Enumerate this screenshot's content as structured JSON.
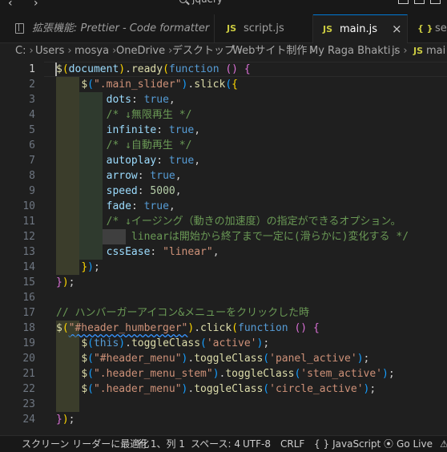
{
  "titlebar": {
    "back": "‹",
    "forward": "›",
    "search_text": "jquery"
  },
  "tabs": [
    {
      "icon": "",
      "label": "拡張機能: Prettier - Code formatter",
      "active": false,
      "italic": true
    },
    {
      "icon": "JS",
      "label": "script.js",
      "active": false
    },
    {
      "icon": "JS",
      "label": "main.js",
      "active": true,
      "close": "×"
    },
    {
      "icon": "{ }",
      "label": "set",
      "active": false
    }
  ],
  "breadcrumbs": [
    "C:",
    "Users",
    "mosya",
    "OneDrive",
    "デスクトップ",
    "Webサイト制作",
    "My Raga Bhakti",
    "js",
    "mai"
  ],
  "breadcrumb_last_icon": "JS",
  "editor": {
    "lines": [
      {
        "n": "1",
        "tokens": [
          [
            "t-fn",
            "$"
          ],
          [
            "t-b1",
            "("
          ],
          [
            "t-prop",
            "document"
          ],
          [
            "t-b1",
            ")"
          ],
          [
            "t-punc",
            "."
          ],
          [
            "t-fn",
            "ready"
          ],
          [
            "t-b1",
            "("
          ],
          [
            "t-kw",
            "function"
          ],
          [
            "t-punc",
            " "
          ],
          [
            "t-b2",
            "()"
          ],
          [
            "t-punc",
            " "
          ],
          [
            "t-b2",
            "{"
          ]
        ]
      },
      {
        "n": "2",
        "tokens": [
          [
            "t-punc",
            "    "
          ],
          [
            "t-fn",
            "$"
          ],
          [
            "t-b3",
            "("
          ],
          [
            "t-str",
            "\".main_slider\""
          ],
          [
            "t-b3",
            ")"
          ],
          [
            "t-punc",
            "."
          ],
          [
            "t-fn",
            "slick"
          ],
          [
            "t-b3",
            "("
          ],
          [
            "t-b1",
            "{"
          ]
        ]
      },
      {
        "n": "3",
        "tokens": [
          [
            "t-punc",
            "        "
          ],
          [
            "t-prop",
            "dots"
          ],
          [
            "t-punc",
            ": "
          ],
          [
            "t-kw",
            "true"
          ],
          [
            "t-punc",
            ","
          ]
        ]
      },
      {
        "n": "4",
        "tokens": [
          [
            "t-punc",
            "        "
          ],
          [
            "t-com",
            "/* ↓無限再生 */"
          ]
        ]
      },
      {
        "n": "5",
        "tokens": [
          [
            "t-punc",
            "        "
          ],
          [
            "t-prop",
            "infinite"
          ],
          [
            "t-punc",
            ": "
          ],
          [
            "t-kw",
            "true"
          ],
          [
            "t-punc",
            ","
          ]
        ]
      },
      {
        "n": "6",
        "tokens": [
          [
            "t-punc",
            "        "
          ],
          [
            "t-com",
            "/* ↓自動再生 */"
          ]
        ]
      },
      {
        "n": "7",
        "tokens": [
          [
            "t-punc",
            "        "
          ],
          [
            "t-prop",
            "autoplay"
          ],
          [
            "t-punc",
            ": "
          ],
          [
            "t-kw",
            "true"
          ],
          [
            "t-punc",
            ","
          ]
        ]
      },
      {
        "n": "8",
        "tokens": [
          [
            "t-punc",
            "        "
          ],
          [
            "t-prop",
            "arrow"
          ],
          [
            "t-punc",
            ": "
          ],
          [
            "t-kw",
            "true"
          ],
          [
            "t-punc",
            ","
          ]
        ]
      },
      {
        "n": "9",
        "tokens": [
          [
            "t-punc",
            "        "
          ],
          [
            "t-prop",
            "speed"
          ],
          [
            "t-punc",
            ": "
          ],
          [
            "t-num",
            "5000"
          ],
          [
            "t-punc",
            ","
          ]
        ]
      },
      {
        "n": "10",
        "tokens": [
          [
            "t-punc",
            "        "
          ],
          [
            "t-prop",
            "fade"
          ],
          [
            "t-punc",
            ": "
          ],
          [
            "t-kw",
            "true"
          ],
          [
            "t-punc",
            ","
          ]
        ]
      },
      {
        "n": "11",
        "tokens": [
          [
            "t-punc",
            "        "
          ],
          [
            "t-com",
            "/* ↓イージング（動きの加速度）の指定ができるオプション。"
          ]
        ]
      },
      {
        "n": "12",
        "tokens": [
          [
            "t-punc",
            "            "
          ],
          [
            "t-com",
            "linearは開始から終了まで一定に(滑らかに)変化する */"
          ]
        ]
      },
      {
        "n": "13",
        "tokens": [
          [
            "t-punc",
            "        "
          ],
          [
            "t-prop",
            "cssEase"
          ],
          [
            "t-punc",
            ": "
          ],
          [
            "t-str",
            "\"linear\""
          ],
          [
            "t-punc",
            ","
          ]
        ]
      },
      {
        "n": "14",
        "tokens": [
          [
            "t-punc",
            "    "
          ],
          [
            "t-b1",
            "}"
          ],
          [
            "t-b3",
            ")"
          ],
          [
            "t-punc",
            ";"
          ]
        ]
      },
      {
        "n": "15",
        "tokens": [
          [
            "t-b2",
            "}"
          ],
          [
            "t-b1",
            ")"
          ],
          [
            "t-punc",
            ";"
          ]
        ]
      },
      {
        "n": "16",
        "tokens": []
      },
      {
        "n": "17",
        "tokens": [
          [
            "t-com",
            "// ハンバーガーアイコン&メニューをクリックした時"
          ]
        ]
      },
      {
        "n": "18",
        "tokens": [
          [
            "t-fn",
            "$"
          ],
          [
            "t-b1",
            "("
          ],
          [
            "t-str sq",
            "\"#header_humberger\""
          ],
          [
            "t-b1",
            ")"
          ],
          [
            "t-punc",
            "."
          ],
          [
            "t-fn",
            "click"
          ],
          [
            "t-b1",
            "("
          ],
          [
            "t-kw",
            "function"
          ],
          [
            "t-punc",
            " "
          ],
          [
            "t-b2",
            "()"
          ],
          [
            "t-punc",
            " "
          ],
          [
            "t-b2",
            "{"
          ]
        ]
      },
      {
        "n": "19",
        "tokens": [
          [
            "t-punc",
            "    "
          ],
          [
            "t-fn",
            "$"
          ],
          [
            "t-b3",
            "("
          ],
          [
            "t-kw",
            "this"
          ],
          [
            "t-b3",
            ")"
          ],
          [
            "t-punc",
            "."
          ],
          [
            "t-fn",
            "toggleClass"
          ],
          [
            "t-b3",
            "("
          ],
          [
            "t-str",
            "'active'"
          ],
          [
            "t-b3",
            ")"
          ],
          [
            "t-punc",
            ";"
          ]
        ]
      },
      {
        "n": "20",
        "tokens": [
          [
            "t-punc",
            "    "
          ],
          [
            "t-fn",
            "$"
          ],
          [
            "t-b3",
            "("
          ],
          [
            "t-str",
            "\"#header_menu\""
          ],
          [
            "t-b3",
            ")"
          ],
          [
            "t-punc",
            "."
          ],
          [
            "t-fn",
            "toggleClass"
          ],
          [
            "t-b3",
            "("
          ],
          [
            "t-str",
            "'panel_active'"
          ],
          [
            "t-b3",
            ")"
          ],
          [
            "t-punc",
            ";"
          ]
        ]
      },
      {
        "n": "21",
        "tokens": [
          [
            "t-punc",
            "    "
          ],
          [
            "t-fn",
            "$"
          ],
          [
            "t-b3",
            "("
          ],
          [
            "t-str",
            "\".header_menu_stem\""
          ],
          [
            "t-b3",
            ")"
          ],
          [
            "t-punc",
            "."
          ],
          [
            "t-fn",
            "toggleClass"
          ],
          [
            "t-b3",
            "("
          ],
          [
            "t-str",
            "'stem_active'"
          ],
          [
            "t-b3",
            ")"
          ],
          [
            "t-punc",
            ";"
          ]
        ]
      },
      {
        "n": "22",
        "tokens": [
          [
            "t-punc",
            "    "
          ],
          [
            "t-fn",
            "$"
          ],
          [
            "t-b3",
            "("
          ],
          [
            "t-str",
            "\".header_menu\""
          ],
          [
            "t-b3",
            ")"
          ],
          [
            "t-punc",
            "."
          ],
          [
            "t-fn",
            "toggleClass"
          ],
          [
            "t-b3",
            "("
          ],
          [
            "t-str",
            "'circle_active'"
          ],
          [
            "t-b3",
            ")"
          ],
          [
            "t-punc",
            ";"
          ]
        ]
      },
      {
        "n": "23",
        "tokens": []
      },
      {
        "n": "24",
        "tokens": [
          [
            "t-b2",
            "}"
          ],
          [
            "t-b1",
            ")"
          ],
          [
            "t-punc",
            ";"
          ]
        ]
      }
    ]
  },
  "statusbar": {
    "screen_reader": "スクリーン リーダーに最適化",
    "position": "行 1、列 1",
    "spaces": "スペース: 4",
    "encoding": "UTF-8",
    "eol": "CRLF",
    "lang_icon": "{ }",
    "language": "JavaScript",
    "golive_icon": "⦿",
    "golive": "Go Live",
    "warn_icon": "⚠"
  },
  "colors": {
    "accent": "#0078d4",
    "background": "#1f1f1f",
    "js_icon": "#cbcb41"
  }
}
